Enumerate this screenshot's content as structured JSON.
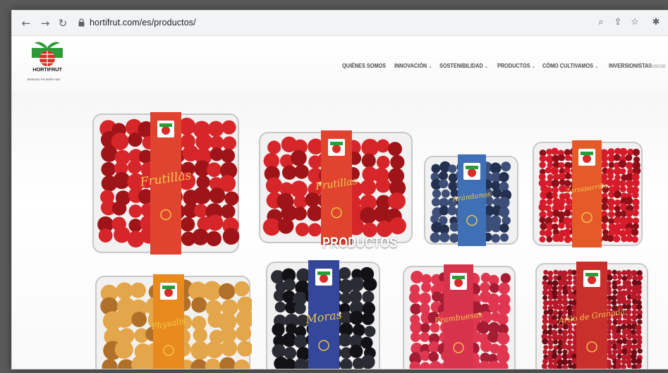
{
  "browser": {
    "url": "hortifrut.com/es/productos/",
    "back_icon": "arrow-left-icon",
    "forward_icon": "arrow-right-icon",
    "reload_icon": "reload-icon"
  },
  "header": {
    "logo_name": "HORTIFRUT",
    "logo_tagline": "BRINGING THE BERRY WAY",
    "search_label": "Buscar",
    "menu": [
      {
        "label": "QUIÉNES SOMOS",
        "has_dropdown": false
      },
      {
        "label": "INNOVACIÓN",
        "has_dropdown": true
      },
      {
        "label": "SOSTENIBILIDAD",
        "has_dropdown": true
      },
      {
        "label": "PRODUCTOS",
        "has_dropdown": true
      },
      {
        "label": "CÓMO CULTIVAMOS",
        "has_dropdown": true
      },
      {
        "label": "INVERSIONISTAS",
        "has_dropdown": false
      }
    ]
  },
  "hero": {
    "title": "PRODUCTOS"
  },
  "products": [
    {
      "name": "Frutillas",
      "fruit": "strawberry",
      "band_color": "#e0442f"
    },
    {
      "name": "Frutillas",
      "fruit": "strawberry",
      "band_color": "#e0442f"
    },
    {
      "name": "Arándanos",
      "fruit": "blueberry",
      "band_color": "#3f6fb5"
    },
    {
      "name": "Zarzaparrilla",
      "fruit": "redcurrant",
      "band_color": "#e65a2a"
    },
    {
      "name": "Physalis",
      "fruit": "physalis",
      "band_color": "#e98a1e"
    },
    {
      "name": "Moras",
      "fruit": "blackberry",
      "band_color": "#34479a"
    },
    {
      "name": "Frambuesas",
      "fruit": "raspberry",
      "band_color": "#d8334d"
    },
    {
      "name": "Arilo de Granada",
      "fruit": "pomegranate",
      "band_color": "#c9302c"
    }
  ],
  "colors": {
    "brand_red": "#d92b27",
    "brand_green": "#2f9a3a",
    "band_text": "#f2c94c"
  }
}
